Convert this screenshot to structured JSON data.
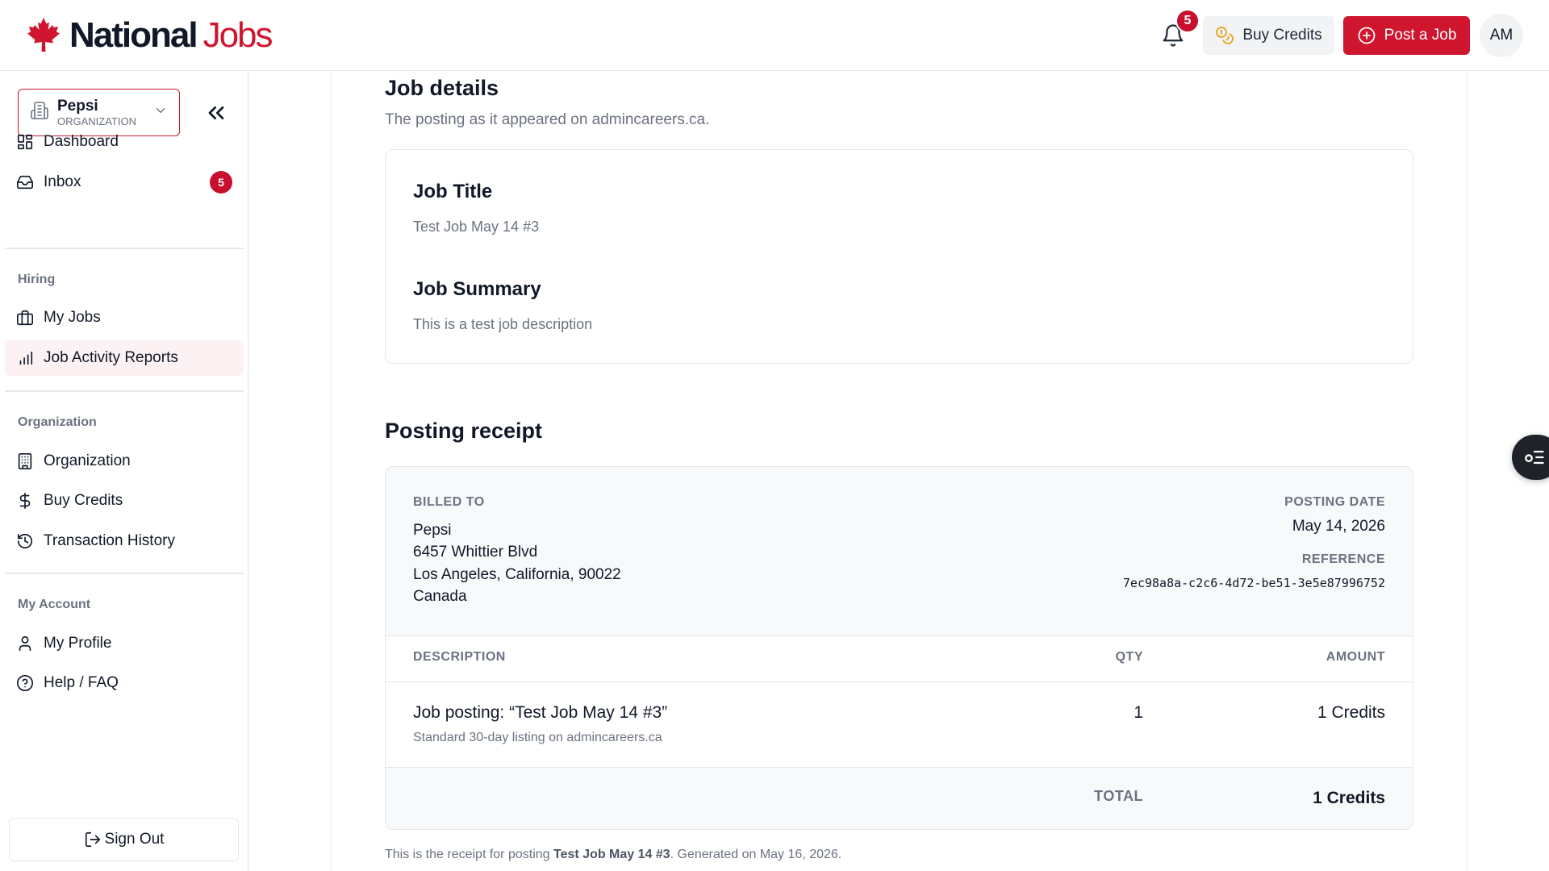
{
  "brand": {
    "name_primary": "National",
    "name_secondary": "Jobs"
  },
  "header": {
    "notifications_count": "5",
    "buy_credits_label": "Buy Credits",
    "post_job_label": "Post a Job",
    "avatar_initials": "AM"
  },
  "sidebar": {
    "org_name": "Pepsi",
    "org_type": "ORGANIZATION",
    "items": [
      {
        "label": "Dashboard",
        "icon": "dashboard-icon"
      },
      {
        "label": "Inbox",
        "icon": "inbox-icon",
        "badge": "5"
      }
    ],
    "sections": [
      {
        "title": "Hiring",
        "items": [
          {
            "label": "My Jobs",
            "icon": "briefcase-icon"
          },
          {
            "label": "Job Activity Reports",
            "icon": "bar-chart-icon",
            "active": true
          }
        ]
      },
      {
        "title": "Organization",
        "items": [
          {
            "label": "Organization",
            "icon": "building-icon"
          },
          {
            "label": "Buy Credits",
            "icon": "dollar-icon"
          },
          {
            "label": "Transaction History",
            "icon": "history-icon"
          }
        ]
      },
      {
        "title": "My Account",
        "items": [
          {
            "label": "My Profile",
            "icon": "user-icon"
          },
          {
            "label": "Help / FAQ",
            "icon": "help-icon"
          }
        ]
      }
    ],
    "sign_out_label": "Sign Out"
  },
  "job_details": {
    "title": "Job details",
    "subtitle": "The posting as it appeared on admincareers.ca.",
    "job_title_label": "Job Title",
    "job_title_value": "Test Job May 14 #3",
    "job_summary_label": "Job Summary",
    "job_summary_value": "This is a test job description"
  },
  "receipt": {
    "title": "Posting receipt",
    "billed_to_label": "BILLED TO",
    "billed_to": [
      "Pepsi",
      "6457 Whittier Blvd",
      "Los Angeles, California, 90022",
      "Canada"
    ],
    "posting_date_label": "POSTING DATE",
    "posting_date": "May 14, 2026",
    "reference_label": "REFERENCE",
    "reference": "7ec98a8a-c2c6-4d72-be51-3e5e87996752",
    "columns": {
      "description": "DESCRIPTION",
      "qty": "QTY",
      "amount": "AMOUNT"
    },
    "line_item": {
      "description": "Job posting: “Test Job May 14 #3”",
      "sub": "Standard 30-day listing on admincareers.ca",
      "qty": "1",
      "amount": "1 Credits"
    },
    "total_label": "TOTAL",
    "total_value": "1 Credits"
  },
  "footer": {
    "prefix": "This is the receipt for posting ",
    "job": "Test Job May 14 #3",
    "suffix": ". Generated on May 16, 2026."
  },
  "colors": {
    "brand_red": "#d0162f",
    "badge_red": "#c8102e",
    "muted": "#6b7280"
  }
}
